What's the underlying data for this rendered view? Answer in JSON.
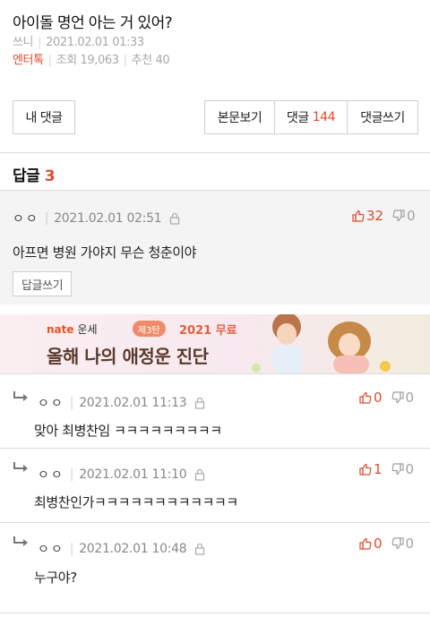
{
  "post": {
    "title": "아이돌 명언 아는 거 있어?",
    "author": "쓰니",
    "datetime": "2021.02.01 01:33",
    "category": "엔터톡",
    "views": "조회 19,063",
    "recommends": "추천 40"
  },
  "buttons": {
    "my_comments": "내 댓글",
    "view_post": "본문보기",
    "comments_label": "댓글",
    "comments_count": "144",
    "write_comment": "댓글쓰기"
  },
  "replies": {
    "label": "답글",
    "count": "3"
  },
  "best_comment": {
    "user": "ㅇㅇ",
    "datetime": "2021.02.01 02:51",
    "likes": "32",
    "dislikes": "0",
    "text": "아프면 병원 가야지 무슨 청춘이야",
    "reply_button": "답글쓰기"
  },
  "ad": {
    "brand": "nate",
    "brand_sub": "운세",
    "badge": "제3탄",
    "promo": "2021 무료",
    "headline": "올해 나의 애정운 진단"
  },
  "comments": [
    {
      "user": "ㅇㅇ",
      "datetime": "2021.02.01 11:13",
      "likes": "0",
      "dislikes": "0",
      "text": "맞아 최병찬임 ㅋㅋㅋㅋㅋㅋㅋㅋㅋ"
    },
    {
      "user": "ㅇㅇ",
      "datetime": "2021.02.01 11:10",
      "likes": "1",
      "dislikes": "0",
      "text": "최병찬인가ㅋㅋㅋㅋㅋㅋㅋㅋㅋㅋㅋㅋ"
    },
    {
      "user": "ㅇㅇ",
      "datetime": "2021.02.01 10:48",
      "likes": "0",
      "dislikes": "0",
      "text": "누구야?"
    }
  ],
  "colors": {
    "accent": "#e04a2c",
    "muted": "#a9a9a9",
    "best_bg": "#f4f4f4"
  }
}
